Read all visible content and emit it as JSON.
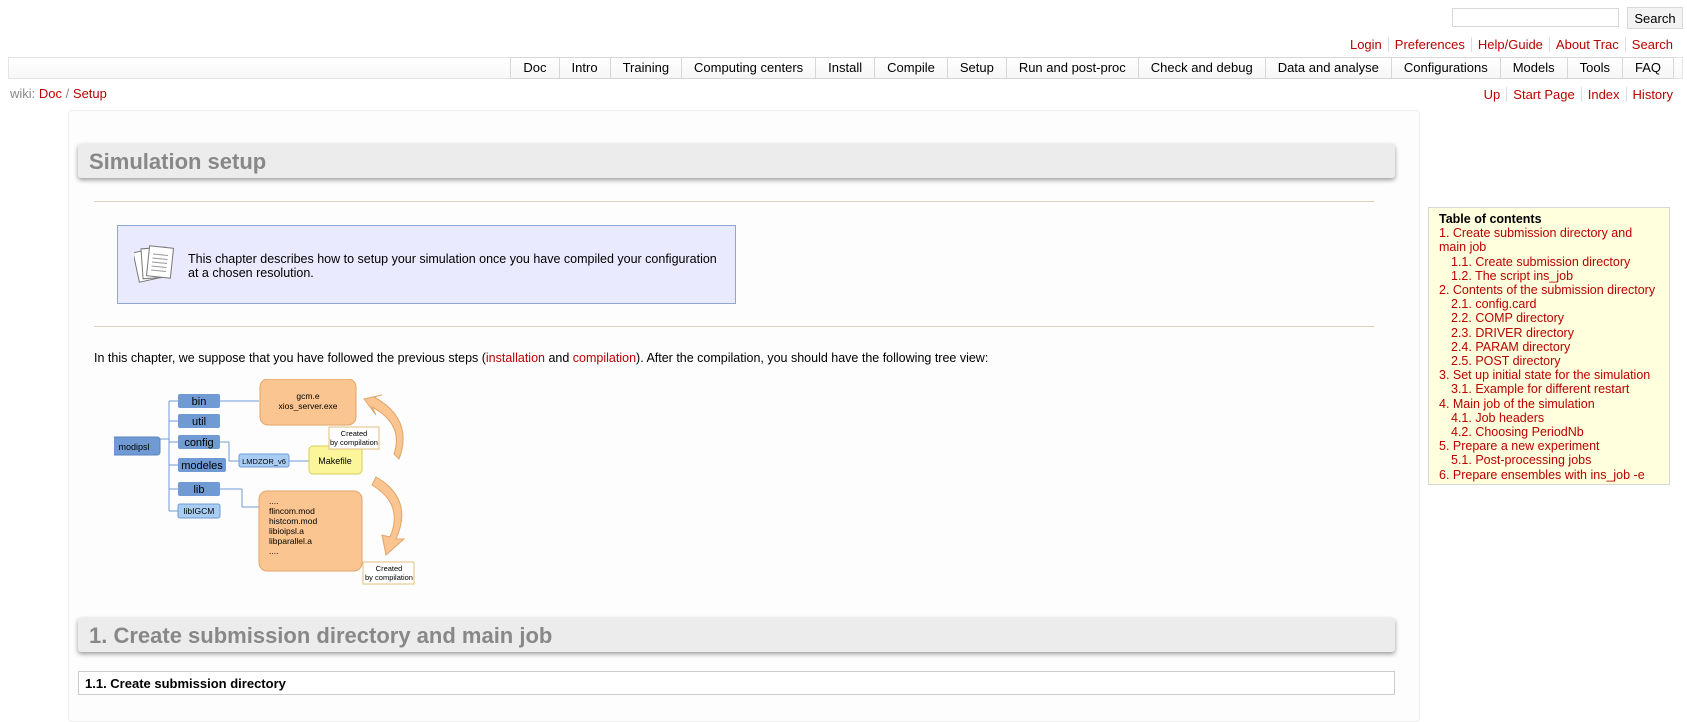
{
  "search": {
    "placeholder": "",
    "button_label": "Search"
  },
  "metanav": [
    "Login",
    "Preferences",
    "Help/Guide",
    "About Trac",
    "Search"
  ],
  "mainnav": [
    "Doc",
    "Intro",
    "Training",
    "Computing centers",
    "Install",
    "Compile",
    "Setup",
    "Run and post-proc",
    "Check and debug",
    "Data and analyse",
    "Configurations",
    "Models",
    "Tools",
    "FAQ"
  ],
  "breadcrumb": {
    "prefix": "wiki:",
    "items": [
      "Doc",
      "Setup"
    ],
    "separator": "/"
  },
  "ctxtnav": [
    "Up",
    "Start Page",
    "Index",
    "History"
  ],
  "page_title": "Simulation setup",
  "note_text": "This chapter describes how to setup your simulation once you have compiled your configuration at a chosen resolution.",
  "intro": {
    "before": "In this chapter, we suppose that you have followed the previous steps (",
    "link1": "installation",
    "middle": " and ",
    "link2": "compilation",
    "after": "). After the compilation, you should have the following tree view:"
  },
  "tree": {
    "root": "modipsl",
    "dirs": [
      "bin",
      "util",
      "config",
      "modeles",
      "lib",
      "libIGCM"
    ],
    "config_sub": "LMDZOR_v6",
    "makefile": "Makefile",
    "bin_files": [
      "gcm.e",
      "xios_server.exe"
    ],
    "lib_files": [
      "....",
      "flincom.mod",
      "histcom.mod",
      "libioipsl.a",
      "libparallel.a",
      "...."
    ],
    "created_note": [
      "Created",
      "by compilation"
    ]
  },
  "section1_title": "1. Create submission directory and main job",
  "section11_title": "1.1. Create submission directory",
  "toc": {
    "title": "Table of contents",
    "items": [
      {
        "label": "1. Create submission directory and main job",
        "level": 1
      },
      {
        "label": "1.1. Create submission directory",
        "level": 2
      },
      {
        "label": "1.2. The script ins_job",
        "level": 2
      },
      {
        "label": "2. Contents of the submission directory",
        "level": 1
      },
      {
        "label": "2.1. config.card",
        "level": 2
      },
      {
        "label": "2.2. COMP directory",
        "level": 2
      },
      {
        "label": "2.3. DRIVER directory",
        "level": 2
      },
      {
        "label": "2.4. PARAM directory",
        "level": 2
      },
      {
        "label": "2.5. POST directory",
        "level": 2
      },
      {
        "label": "3. Set up initial state for the simulation",
        "level": 1
      },
      {
        "label": "3.1. Example for different restart",
        "level": 2
      },
      {
        "label": "4. Main job of the simulation",
        "level": 1
      },
      {
        "label": "4.1. Job headers",
        "level": 2
      },
      {
        "label": "4.2. Choosing PeriodNb",
        "level": 2
      },
      {
        "label": "5. Prepare a new experiment",
        "level": 1
      },
      {
        "label": "5.1. Post-processing jobs",
        "level": 2
      },
      {
        "label": "6. Prepare ensembles with ins_job -e",
        "level": 1
      }
    ]
  },
  "colors": {
    "link": "#bb0000",
    "dir_box": "#6f9ad3",
    "file_box": "#fbc591",
    "makefile_box": "#fbf69a",
    "note_bg": "#eaeaff",
    "toc_bg": "#ffffdd"
  }
}
